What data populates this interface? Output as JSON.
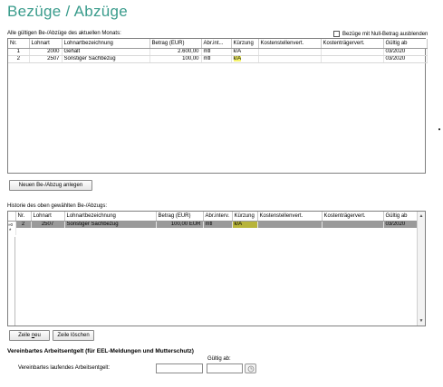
{
  "page": {
    "title": "Bezüge / Abzüge",
    "current_label": "Alle gültigen Be-/Abzüge des aktuellen Monats:",
    "hide_zero_label": "Bezüge mit Null-Betrag ausblenden",
    "history_label": "Historie des oben gewählten Be-/Abzugs:"
  },
  "grid1": {
    "headers": [
      "Nr.",
      "Lohnart",
      "Lohnartbezeichnung",
      "Betrag (EUR)",
      "Abr.int...",
      "Kürzung",
      "Kostenstellenvert.",
      "Kostenträgervert.",
      "Gültig ab"
    ],
    "rows": [
      {
        "nr": "1",
        "lohnart": "2000",
        "bez": "Gehalt",
        "betrag": "2.600,00",
        "abr": "mtl",
        "kuerzung": "k/A",
        "kst": "",
        "ktr": "",
        "gueltig": "03/2020"
      },
      {
        "nr": "2",
        "lohnart": "2507",
        "bez": "Sonstiger Sachbezug",
        "betrag": "100,00",
        "abr": "mtl",
        "kuerzung": "k/A",
        "kst": "",
        "ktr": "",
        "gueltig": "03/2020"
      }
    ]
  },
  "buttons": {
    "new_entry": "Neuen Be-/Abzug anlegen",
    "new_row_pre": "Zeile ",
    "new_row_ul": "n",
    "new_row_post": "eu",
    "delete_row": "Zeile löschen"
  },
  "grid2": {
    "headers": [
      "Nr.",
      "Lohnart",
      "Lohnartbezeichnung",
      "Betrag (EUR)",
      "Abr.interv.",
      "Kürzung",
      "Kostenstellenvert.",
      "Kostenträgervert.",
      "Gültig ab"
    ],
    "rows": [
      {
        "marker": "»0",
        "nr": "2",
        "lohnart": "2507",
        "bez": "Sonstiger Sachbezug",
        "betrag": "100,00 EUR",
        "abr": "mtl",
        "kuerzung": "k/A",
        "kst": "",
        "ktr": "",
        "gueltig": "03/2020"
      }
    ],
    "new_row_marker": "*"
  },
  "footer": {
    "title": "Vereinbartes Arbeitsentgelt (für EEL-Meldungen und Mutterschutz)",
    "gueltig_label": "Gültig ab:",
    "field_label": "Vereinbartes laufendes Arbeitsentgelt:",
    "amount_value": "",
    "date_value": ""
  },
  "icons": {
    "scroll_up": "scroll-up-arrow-icon",
    "scroll_down": "scroll-down-arrow-icon",
    "calendar": "calendar-icon"
  },
  "colors": {
    "title": "#3a9c8c",
    "highlight": "#f4f26a",
    "selected_row": "#9a9a9a"
  }
}
